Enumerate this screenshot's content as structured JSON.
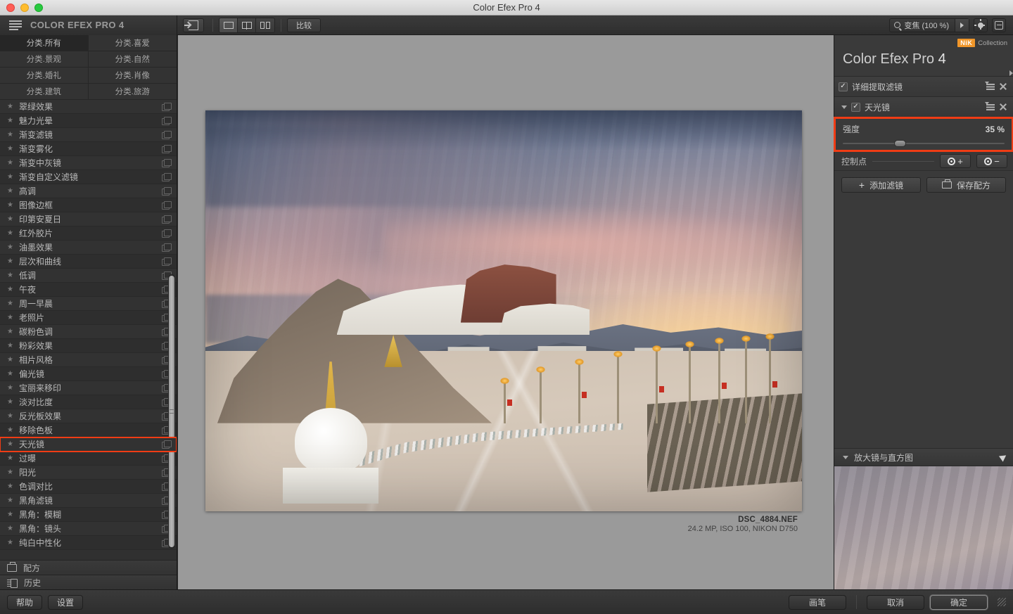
{
  "window": {
    "title": "Color Efex Pro 4"
  },
  "toolbar": {
    "app_title": "COLOR EFEX PRO 4",
    "menu_icon": "hamburger-icon",
    "export_icon": "export-icon",
    "view_single_icon": "single-view-icon",
    "view_split_icon": "split-view-icon",
    "view_side_icon": "side-by-side-view-icon",
    "compare_label": "比较",
    "zoom_label": "变焦 (100 %)",
    "zoom_search_icon": "search-icon",
    "zoom_arrow_icon": "triangle-right-icon",
    "brightness_icon": "brightness-icon",
    "signin_icon": "sign-in-icon"
  },
  "categories": [
    {
      "label": "分类.所有",
      "selected": true
    },
    {
      "label": "分类.喜爱",
      "selected": false
    },
    {
      "label": "分类.景观",
      "selected": false
    },
    {
      "label": "分类.自然",
      "selected": false
    },
    {
      "label": "分类.婚礼",
      "selected": false
    },
    {
      "label": "分类.肖像",
      "selected": false
    },
    {
      "label": "分类.建筑",
      "selected": false
    },
    {
      "label": "分类.旅游",
      "selected": false
    }
  ],
  "filters": [
    {
      "name": "翠绿效果",
      "highlight": false
    },
    {
      "name": "魅力光晕",
      "highlight": false
    },
    {
      "name": "渐变滤镜",
      "highlight": false
    },
    {
      "name": "渐变雾化",
      "highlight": false
    },
    {
      "name": "渐变中灰镜",
      "highlight": false
    },
    {
      "name": "渐变自定义滤镜",
      "highlight": false
    },
    {
      "name": "高调",
      "highlight": false
    },
    {
      "name": "图像边框",
      "highlight": false
    },
    {
      "name": "印第安夏日",
      "highlight": false
    },
    {
      "name": "红外胶片",
      "highlight": false
    },
    {
      "name": "油墨效果",
      "highlight": false
    },
    {
      "name": "层次和曲线",
      "highlight": false
    },
    {
      "name": "低调",
      "highlight": false
    },
    {
      "name": "午夜",
      "highlight": false
    },
    {
      "name": "周一早晨",
      "highlight": false
    },
    {
      "name": "老照片",
      "highlight": false
    },
    {
      "name": "碳粉色调",
      "highlight": false
    },
    {
      "name": "粉彩效果",
      "highlight": false
    },
    {
      "name": "相片风格",
      "highlight": false
    },
    {
      "name": "偏光镜",
      "highlight": false
    },
    {
      "name": "宝丽来移印",
      "highlight": false
    },
    {
      "name": "淡对比度",
      "highlight": false
    },
    {
      "name": "反光板效果",
      "highlight": false
    },
    {
      "name": "移除色板",
      "highlight": false
    },
    {
      "name": "天光镜",
      "highlight": true
    },
    {
      "name": "过曝",
      "highlight": false
    },
    {
      "name": "阳光",
      "highlight": false
    },
    {
      "name": "色调对比",
      "highlight": false
    },
    {
      "name": "黑角滤镜",
      "highlight": false
    },
    {
      "name": "黑角：模糊",
      "highlight": false
    },
    {
      "name": "黑角：镜头",
      "highlight": false
    },
    {
      "name": "纯白中性化",
      "highlight": false
    }
  ],
  "left_bottom": {
    "recipes_label": "配方",
    "recipes_icon": "recipe-icon",
    "history_label": "历史",
    "history_icon": "history-icon"
  },
  "canvas": {
    "filename": "DSC_4884.NEF",
    "metadata": "24.2 MP, ISO 100, NIKON D750"
  },
  "right_panel": {
    "nik_badge": "NiK",
    "nik_collection": "Collection",
    "brand_name": "Color Efex Pro",
    "brand_version": "4",
    "filter_stack": [
      {
        "label": "详细提取滤镜",
        "expanded": false,
        "checked": true,
        "check_glyph": "✓"
      },
      {
        "label": "天光镜",
        "expanded": true,
        "checked": true,
        "check_glyph": "✓"
      }
    ],
    "slider": {
      "name": "强度",
      "value": "35 %",
      "percent": 35,
      "highlighted": true
    },
    "control_points": {
      "label": "控制点",
      "add_label": "+",
      "remove_label": "−",
      "add_icon": "add-control-point-icon",
      "remove_icon": "remove-control-point-icon"
    },
    "actions": {
      "add_filter_label": "添加滤镜",
      "add_filter_icon": "plus-icon",
      "save_recipe_label": "保存配方",
      "save_recipe_icon": "save-recipe-icon"
    },
    "loupe": {
      "label": "放大镜与直方图",
      "pin_icon": "pin-icon"
    }
  },
  "bottom_bar": {
    "help_label": "帮助",
    "settings_label": "设置",
    "brush_label": "画笔",
    "cancel_label": "取消",
    "ok_label": "确定",
    "resize_grip": "resize-grip-icon"
  },
  "colors": {
    "highlight": "#f03c15",
    "nik_orange": "#f0962a",
    "panel_bg": "#3a3a3a"
  }
}
